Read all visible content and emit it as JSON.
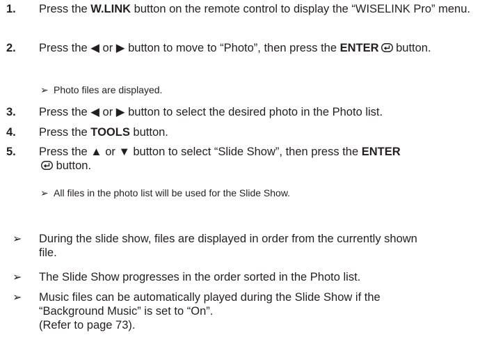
{
  "steps": [
    {
      "num": "1.",
      "pre": "Press the ",
      "bold": "W.LINK",
      "post": " button on the remote control to display the “WISELINK Pro” menu."
    },
    {
      "num": "2.",
      "pre": "Press the ◀ or ▶ button to move to “Photo”, then press the ",
      "bold": "ENTER",
      "post": " button.",
      "sub": "Photo files are displayed."
    },
    {
      "num": "3.",
      "pre": "Press the ◀ or ▶ button to select the desired photo in the Photo list."
    },
    {
      "num": "4.",
      "pre": "Press the ",
      "bold": "TOOLS",
      "post": " button."
    },
    {
      "num": "5.",
      "pre": "Press the ▲ or ▼ button to select “Slide Show”, then press the ",
      "bold": "ENTER",
      "post": " button.",
      "sub": "All files in the photo list will be used for the Slide Show."
    }
  ],
  "notes": [
    "During the slide show, files are displayed in order from the currently shown file.",
    "The Slide Show progresses in the order sorted in the Photo list.",
    "Music files can be automatically played during the Slide Show if the “Background Music” is set to “On”.",
    "(Refer to page 73)."
  ],
  "arrow_glyph": "➢"
}
